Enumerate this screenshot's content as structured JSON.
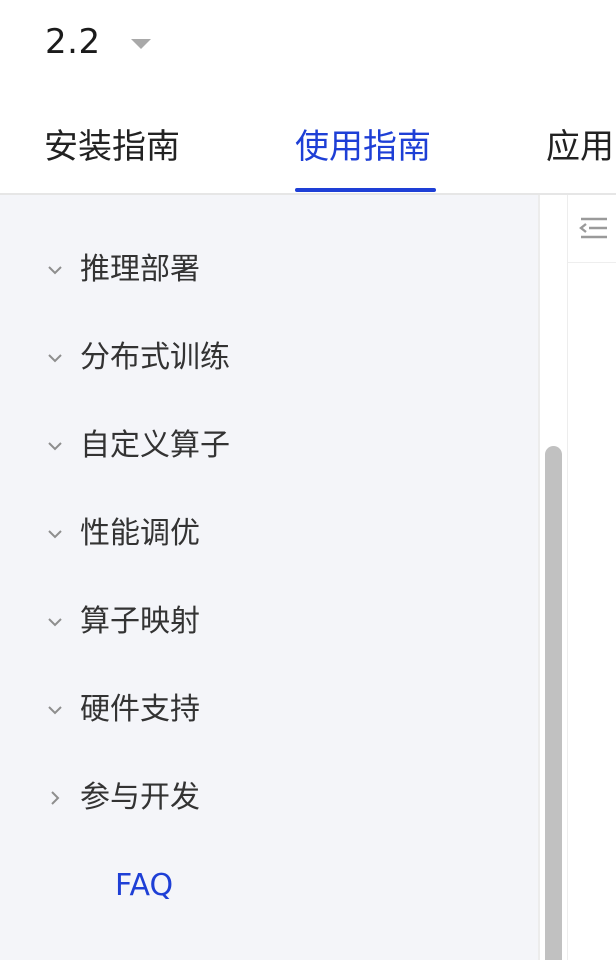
{
  "version": {
    "current": "2.2"
  },
  "tabs": [
    {
      "label": "安装指南",
      "active": false
    },
    {
      "label": "使用指南",
      "active": true
    },
    {
      "label": "应用"
    }
  ],
  "colors": {
    "accent": "#1e3fd6",
    "sidebar_bg": "#f4f5f9",
    "text": "#333333"
  },
  "sidebar": {
    "items": [
      {
        "label": "推理部署",
        "expanded": true,
        "icon": "chevron-down-icon"
      },
      {
        "label": "分布式训练",
        "expanded": true,
        "icon": "chevron-down-icon"
      },
      {
        "label": "自定义算子",
        "expanded": true,
        "icon": "chevron-down-icon"
      },
      {
        "label": "性能调优",
        "expanded": true,
        "icon": "chevron-down-icon"
      },
      {
        "label": "算子映射",
        "expanded": true,
        "icon": "chevron-down-icon"
      },
      {
        "label": "硬件支持",
        "expanded": true,
        "icon": "chevron-down-icon"
      },
      {
        "label": "参与开发",
        "expanded": false,
        "icon": "chevron-right-icon"
      },
      {
        "label": "FAQ",
        "active": true
      }
    ]
  },
  "toolbar": {
    "outline_icon": "outline-toggle-icon"
  }
}
